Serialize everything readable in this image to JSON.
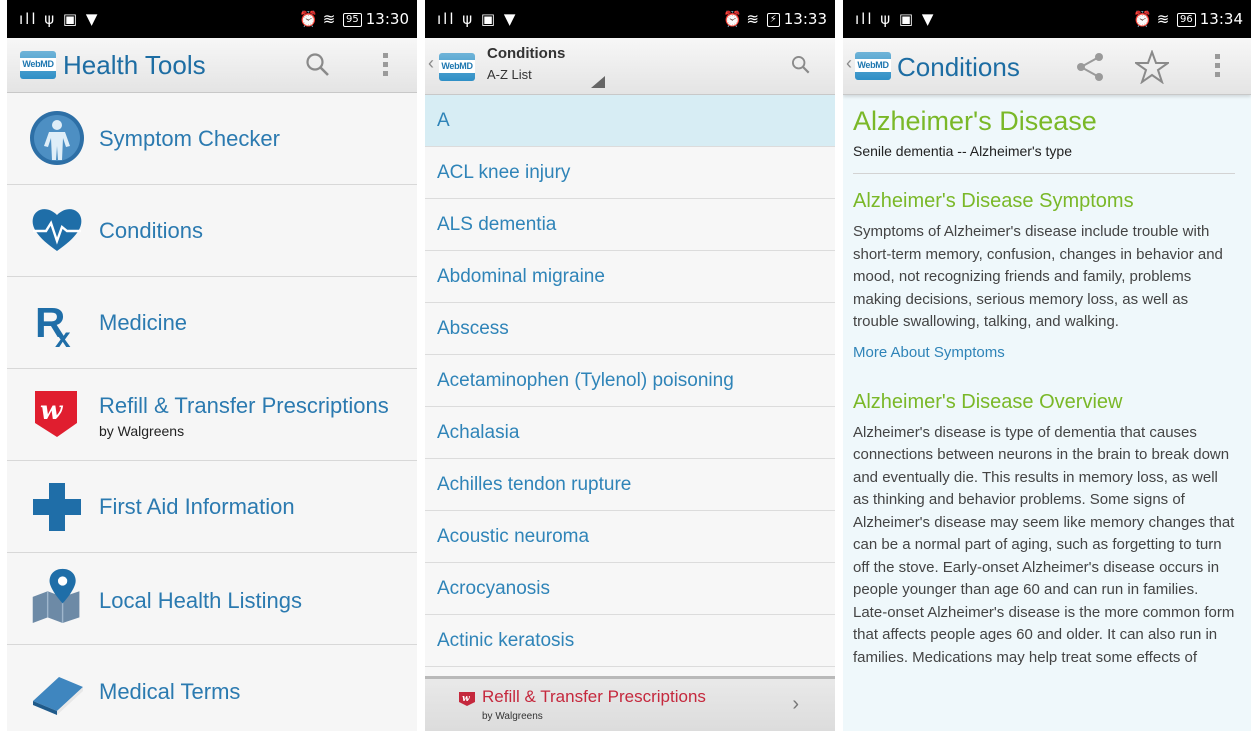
{
  "screens": [
    {
      "status": {
        "signal": "ıll ψ ▣ ▼",
        "battery": "95",
        "time": "13:30"
      },
      "title": "Health Tools",
      "menu": [
        {
          "label": "Symptom Checker",
          "sub": "",
          "icon": "person-body-icon"
        },
        {
          "label": "Conditions",
          "sub": "",
          "icon": "heart-pulse-icon"
        },
        {
          "label": "Medicine",
          "sub": "",
          "icon": "rx-icon"
        },
        {
          "label": "Refill & Transfer Prescriptions",
          "sub": "by Walgreens",
          "icon": "walgreens-icon"
        },
        {
          "label": "First Aid Information",
          "sub": "",
          "icon": "medical-cross-icon"
        },
        {
          "label": "Local Health Listings",
          "sub": "",
          "icon": "map-pin-icon"
        },
        {
          "label": "Medical Terms",
          "sub": "",
          "icon": "book-icon"
        }
      ]
    },
    {
      "status": {
        "signal": "ıll ψ ▣ ▼",
        "battery": "⚡",
        "time": "13:33"
      },
      "title": "Conditions",
      "subtitle": "A-Z List",
      "list": [
        "A",
        "ACL knee injury",
        "ALS dementia",
        "Abdominal migraine",
        "Abscess",
        "Acetaminophen (Tylenol) poisoning",
        "Achalasia",
        "Achilles tendon rupture",
        "Acoustic neuroma",
        "Acrocyanosis",
        "Actinic keratosis"
      ],
      "promo": {
        "title": "Refill & Transfer Prescriptions",
        "sub": "by Walgreens"
      }
    },
    {
      "status": {
        "signal": "ıll ψ ▣ ▼",
        "battery": "96",
        "time": "13:34"
      },
      "title": "Conditions",
      "article": {
        "title": "Alzheimer's Disease",
        "subtitle": "Senile dementia -- Alzheimer's type",
        "s1_title": "Alzheimer's Disease Symptoms",
        "s1_body": "Symptoms of Alzheimer's disease include trouble with short-term memory, confusion, changes in behavior and mood, not recognizing friends and family, problems making decisions, serious memory loss, as well as trouble swallowing, talking, and walking.",
        "s1_link": "More About Symptoms",
        "s2_title": "Alzheimer's Disease Overview",
        "s2_body": "Alzheimer's disease is type of dementia that causes connections between neurons in the brain to break down and eventually die. This results in memory loss, as well as thinking and behavior problems. Some signs of Alzheimer's disease may seem like memory changes that can be a normal part of aging, such as forgetting to turn off the stove. Early-onset Alzheimer's disease occurs in people younger than age 60 and can run in families. Late-onset Alzheimer's disease is the more common form that affects people ages 60 and older. It can also run in families. Medications may help treat some effects of"
      }
    }
  ],
  "logo_text": "WebMD",
  "colors": {
    "accent_blue": "#2b7ab0",
    "accent_green": "#7ab828",
    "walgreens_red": "#c5283d"
  }
}
